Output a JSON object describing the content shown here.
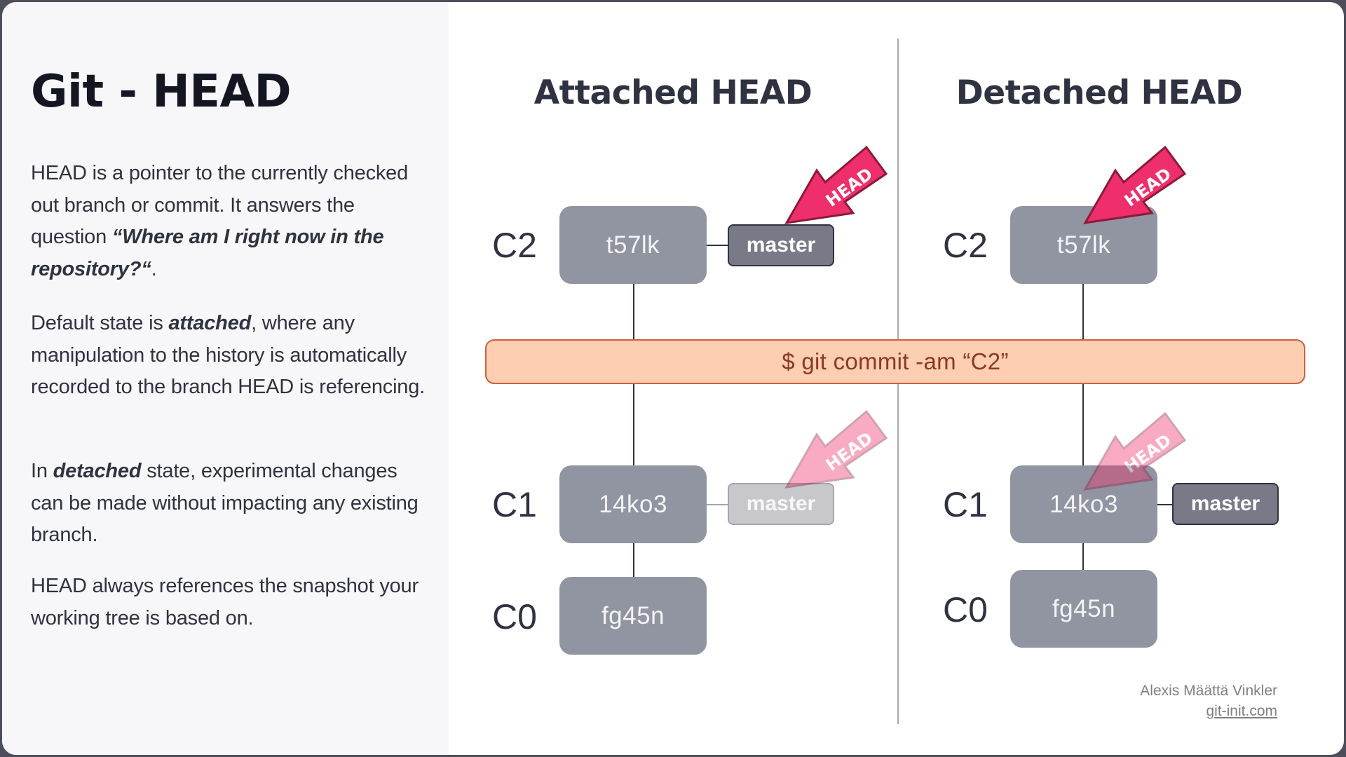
{
  "sidebar": {
    "title": "Git - HEAD",
    "paragraphs": [
      {
        "p1a": "HEAD is a pointer to the currently checked out branch or commit. It answers the question ",
        "p1b": "“Where am I right now in the repository?“",
        "p1c": "."
      },
      {
        "p2a": "Default state is ",
        "p2b": "attached",
        "p2c": ", where any manipulation to the history is automatically recorded to the branch HEAD is referencing."
      },
      {
        "p3a": "In ",
        "p3b": "detached",
        "p3c": " state, experimental changes can be made without impacting any existing branch."
      },
      {
        "p4": "HEAD always references the snapshot your working tree is based on."
      }
    ]
  },
  "columns": {
    "attached": {
      "title": "Attached HEAD",
      "commits": [
        {
          "label": "C2",
          "hash": "t57lk"
        },
        {
          "label": "C1",
          "hash": "14ko3"
        },
        {
          "label": "C0",
          "hash": "fg45n"
        }
      ],
      "branch_after": "master",
      "branch_before": "master",
      "head_after_target": "master",
      "head_before_target": "master"
    },
    "detached": {
      "title": "Detached HEAD",
      "commits": [
        {
          "label": "C2",
          "hash": "t57lk"
        },
        {
          "label": "C1",
          "hash": "14ko3"
        },
        {
          "label": "C0",
          "hash": "fg45n"
        }
      ],
      "branch_before": "master",
      "head_after_target": "t57lk",
      "head_before_target": "14ko3"
    }
  },
  "head_label": "HEAD",
  "command": "$ git commit -am “C2”",
  "colors": {
    "head_arrow": "#ee2f6b",
    "head_arrow_stroke": "#8b1a3a",
    "commit_fill": "#9194a1",
    "branch_fill": "#787a88",
    "command_fill": "#fdceb2",
    "command_text": "#8a3a22"
  },
  "credits": {
    "author": "Alexis Määttä Vinkler",
    "site": "git-init.com"
  }
}
